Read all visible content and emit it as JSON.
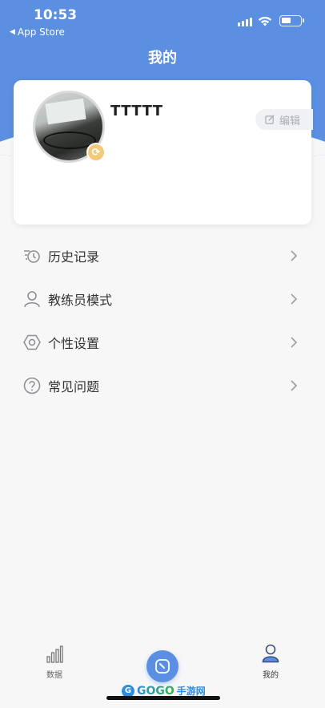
{
  "status_bar": {
    "time": "10:53",
    "back_app": "App Store"
  },
  "header": {
    "title": "我的"
  },
  "profile": {
    "username": "TTTTT",
    "edit_label": "编辑"
  },
  "menu": {
    "items": [
      {
        "label": "历史记录",
        "icon": "history-icon"
      },
      {
        "label": "教练员模式",
        "icon": "person-icon"
      },
      {
        "label": "个性设置",
        "icon": "settings-icon"
      },
      {
        "label": "常见问题",
        "icon": "help-icon"
      }
    ]
  },
  "tabs": {
    "data_label": "数据",
    "mine_label": "我的"
  },
  "watermark": {
    "brand": "GOGO",
    "suffix": "手游网"
  },
  "colors": {
    "primary": "#5b8fe2",
    "background": "#f7f7f8",
    "badge": "#f4c97a"
  }
}
